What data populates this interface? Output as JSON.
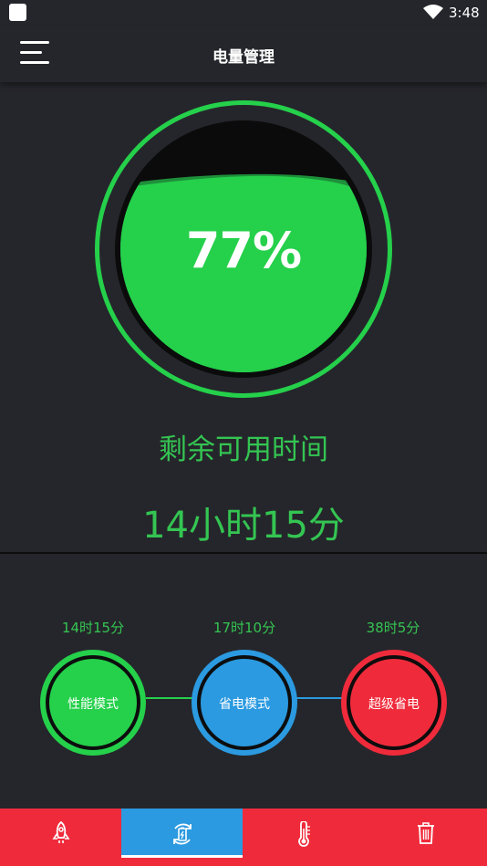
{
  "status_bar": {
    "time": "3:48"
  },
  "header": {
    "title": "电量管理"
  },
  "gauge": {
    "percent_text": "77%",
    "level": 0.77
  },
  "remaining": {
    "label": "剩余可用时间",
    "value": "14小时15分"
  },
  "modes": [
    {
      "name": "性能模式",
      "time": "14时15分",
      "color": "#25d04b",
      "time_color": "#34c552"
    },
    {
      "name": "省电模式",
      "time": "17时10分",
      "color": "#2b9ae0",
      "time_color": "#34c552"
    },
    {
      "name": "超级省电",
      "time": "38时5分",
      "color": "#ef2b3b",
      "time_color": "#34c552"
    }
  ],
  "tabs": [
    {
      "icon": "rocket-icon",
      "active": false
    },
    {
      "icon": "battery-refresh-icon",
      "active": true
    },
    {
      "icon": "thermometer-icon",
      "active": false
    },
    {
      "icon": "trash-icon",
      "active": false
    }
  ],
  "colors": {
    "green": "#25d04b",
    "blue": "#2b9ae0",
    "red": "#ef2b3b",
    "background": "#25262b"
  }
}
